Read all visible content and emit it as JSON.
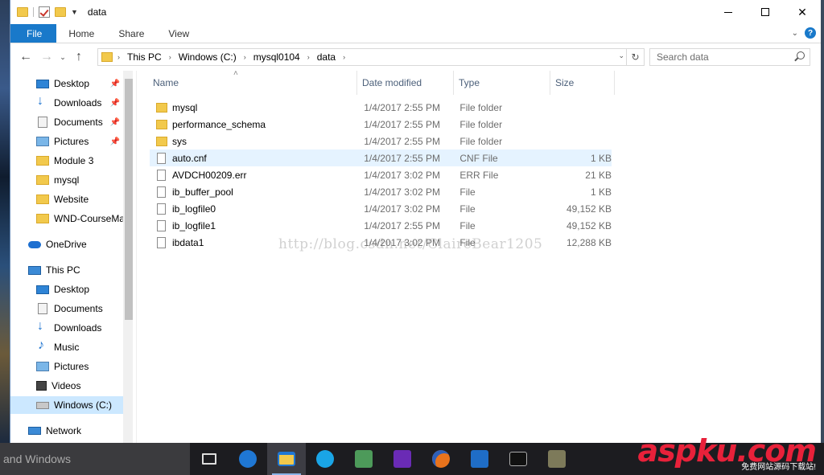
{
  "window": {
    "title": "data",
    "controls": {
      "minimize": "—",
      "maximize": "☐",
      "close": "✕"
    }
  },
  "ribbon": {
    "tabs": [
      "File",
      "Home",
      "Share",
      "View"
    ]
  },
  "address": {
    "crumbs": [
      "This PC",
      "Windows (C:)",
      "mysql0104",
      "data"
    ]
  },
  "search": {
    "placeholder": "Search data"
  },
  "navpane": {
    "items": [
      {
        "label": "Desktop",
        "icon": "desktop-icon",
        "pinned": true
      },
      {
        "label": "Downloads",
        "icon": "downloads-icon",
        "pinned": true
      },
      {
        "label": "Documents",
        "icon": "documents-icon",
        "pinned": true
      },
      {
        "label": "Pictures",
        "icon": "pictures-icon",
        "pinned": true
      },
      {
        "label": "Module 3",
        "icon": "folder-icon",
        "pinned": false
      },
      {
        "label": "mysql",
        "icon": "folder-icon",
        "pinned": false
      },
      {
        "label": "Website",
        "icon": "folder-icon",
        "pinned": false
      },
      {
        "label": "WND-CourseMa",
        "icon": "folder-icon",
        "pinned": false
      },
      {
        "label": "OneDrive",
        "icon": "onedrive-icon",
        "pinned": false
      },
      {
        "label": "This PC",
        "icon": "this-pc-icon",
        "pinned": false
      },
      {
        "label": "Desktop",
        "icon": "desktop-icon",
        "pinned": false
      },
      {
        "label": "Documents",
        "icon": "documents-icon",
        "pinned": false
      },
      {
        "label": "Downloads",
        "icon": "downloads-icon",
        "pinned": false
      },
      {
        "label": "Music",
        "icon": "music-icon",
        "pinned": false
      },
      {
        "label": "Pictures",
        "icon": "pictures-icon",
        "pinned": false
      },
      {
        "label": "Videos",
        "icon": "videos-icon",
        "pinned": false
      },
      {
        "label": "Windows (C:)",
        "icon": "drive-icon",
        "pinned": false,
        "selected": true
      },
      {
        "label": "Network",
        "icon": "network-icon",
        "pinned": false
      }
    ]
  },
  "columns": {
    "name": "Name",
    "date": "Date modified",
    "type": "Type",
    "size": "Size"
  },
  "files": [
    {
      "name": "mysql",
      "date": "1/4/2017 2:55 PM",
      "type": "File folder",
      "size": "",
      "kind": "folder"
    },
    {
      "name": "performance_schema",
      "date": "1/4/2017 2:55 PM",
      "type": "File folder",
      "size": "",
      "kind": "folder"
    },
    {
      "name": "sys",
      "date": "1/4/2017 2:55 PM",
      "type": "File folder",
      "size": "",
      "kind": "folder"
    },
    {
      "name": "auto.cnf",
      "date": "1/4/2017 2:55 PM",
      "type": "CNF File",
      "size": "1 KB",
      "kind": "file",
      "selected": true
    },
    {
      "name": "AVDCH00209.err",
      "date": "1/4/2017 3:02 PM",
      "type": "ERR File",
      "size": "21 KB",
      "kind": "file"
    },
    {
      "name": "ib_buffer_pool",
      "date": "1/4/2017 3:02 PM",
      "type": "File",
      "size": "1 KB",
      "kind": "file"
    },
    {
      "name": "ib_logfile0",
      "date": "1/4/2017 3:02 PM",
      "type": "File",
      "size": "49,152 KB",
      "kind": "file"
    },
    {
      "name": "ib_logfile1",
      "date": "1/4/2017 2:55 PM",
      "type": "File",
      "size": "49,152 KB",
      "kind": "file"
    },
    {
      "name": "ibdata1",
      "date": "1/4/2017 3:02 PM",
      "type": "File",
      "size": "12,288 KB",
      "kind": "file"
    }
  ],
  "watermark": "http://blog.csdn.net/ClaireBear1205",
  "taskbar": {
    "search_text": "and Windows",
    "brand": "aspku.com",
    "brand_sub": "免费网站源码下载站!"
  }
}
